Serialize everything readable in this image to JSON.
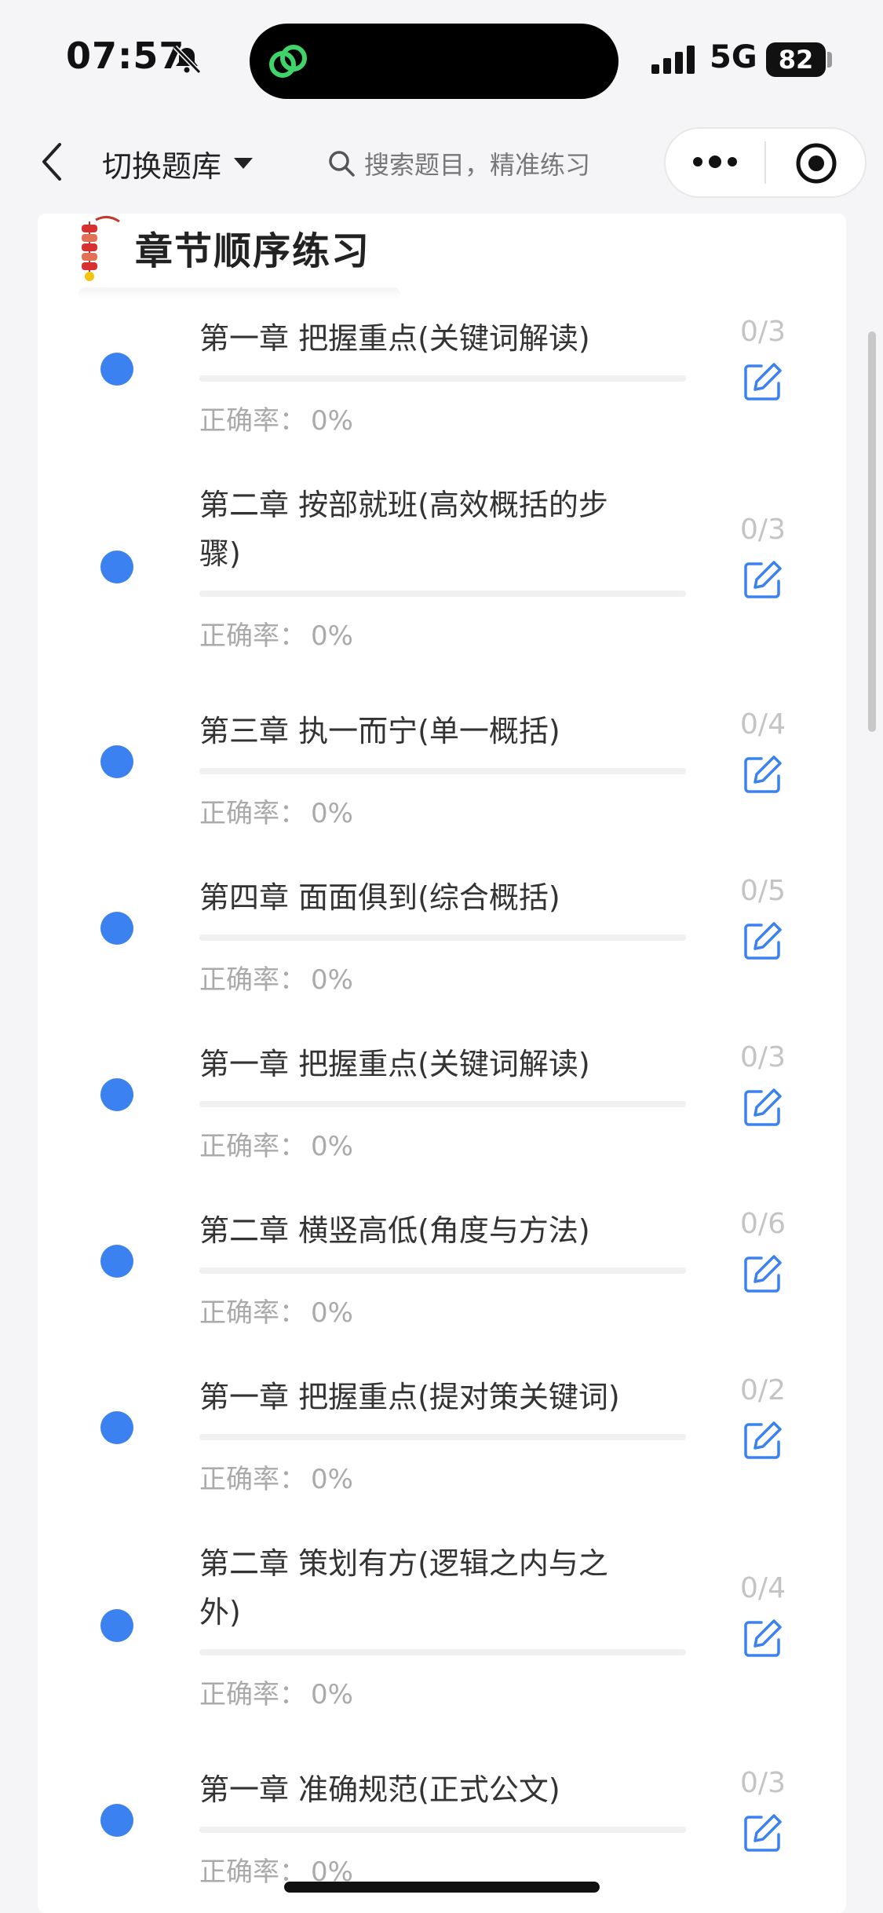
{
  "status_bar": {
    "time": "07:57",
    "network": "5G",
    "battery": "82",
    "icons": [
      "bell-slash-icon",
      "wechat-miniprogram-icon",
      "signal-icon",
      "battery-icon"
    ]
  },
  "nav": {
    "switch_label": "切换题库",
    "search_placeholder": "搜索题目，精准练习",
    "icons": [
      "back-icon",
      "caret-down-icon",
      "search-icon",
      "more-icon",
      "close-miniprogram-icon"
    ]
  },
  "section": {
    "title": "章节顺序练习",
    "icon": "firecracker-icon"
  },
  "colors": {
    "accent": "#3b82f0",
    "count_gray": "#c4c4c4",
    "accuracy_gray": "#aaaaaa"
  },
  "chapters": [
    {
      "line1": "第一章 把握重点(关键词解读)",
      "line2": "",
      "accuracy_label": "正确率：",
      "accuracy_value": "0%",
      "count": "0/3",
      "progress": 0
    },
    {
      "line1": "第二章 按部就班(高效概括的步",
      "line2": "骤)",
      "accuracy_label": "正确率：",
      "accuracy_value": "0%",
      "count": "0/3",
      "progress": 0
    },
    {
      "line1": "第三章 执一而宁(单一概括)",
      "line2": "",
      "accuracy_label": "正确率：",
      "accuracy_value": "0%",
      "count": "0/4",
      "progress": 0
    },
    {
      "line1": "第四章 面面俱到(综合概括)",
      "line2": "",
      "accuracy_label": "正确率：",
      "accuracy_value": "0%",
      "count": "0/5",
      "progress": 0
    },
    {
      "line1": "第一章 把握重点(关键词解读)",
      "line2": "",
      "accuracy_label": "正确率：",
      "accuracy_value": "0%",
      "count": "0/3",
      "progress": 0
    },
    {
      "line1": "第二章 横竖高低(角度与方法)",
      "line2": "",
      "accuracy_label": "正确率：",
      "accuracy_value": "0%",
      "count": "0/6",
      "progress": 0
    },
    {
      "line1": "第一章 把握重点(提对策关键词)",
      "line2": "",
      "accuracy_label": "正确率：",
      "accuracy_value": "0%",
      "count": "0/2",
      "progress": 0
    },
    {
      "line1": "第二章 策划有方(逻辑之内与之",
      "line2": "外)",
      "accuracy_label": "正确率：",
      "accuracy_value": "0%",
      "count": "0/4",
      "progress": 0
    },
    {
      "line1": "第一章 准确规范(正式公文)",
      "line2": "",
      "accuracy_label": "正确率：",
      "accuracy_value": "0%",
      "count": "0/3",
      "progress": 0
    }
  ]
}
